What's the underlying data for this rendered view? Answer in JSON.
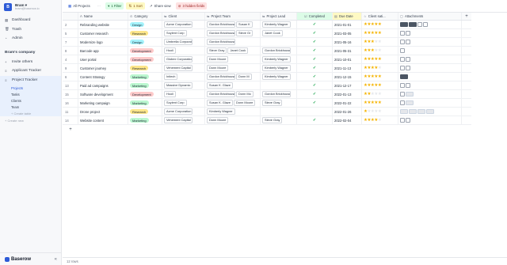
{
  "workspace": {
    "initial": "B",
    "name": "Bram",
    "email": "bram@baserow.io"
  },
  "nav": [
    {
      "icon": "dashboard-icon",
      "glyph": "▦",
      "label": "Dashboard"
    },
    {
      "icon": "trash-icon",
      "glyph": "🗑",
      "label": "Trash"
    },
    {
      "icon": "admin-icon",
      "glyph": "◔",
      "label": "Admin"
    }
  ],
  "company": {
    "title": "Bram's company",
    "items": [
      {
        "icon": "invite-icon",
        "glyph": "+",
        "label": "Invite others"
      },
      {
        "icon": "database-icon",
        "glyph": "≡",
        "label": "Applicant Tracker"
      }
    ],
    "active_db": {
      "glyph": "≡",
      "label": "Project Tracker"
    },
    "tables": [
      "Projects",
      "Tasks",
      "Clients",
      "Team"
    ],
    "create_table": "+ Create table",
    "create_new": "+ Create new"
  },
  "brand": {
    "name": "Baserow",
    "collapse": "«"
  },
  "toolbar": {
    "view": "All Projects",
    "more": "···",
    "filter": "1 Filter",
    "sort": "1 Sort",
    "share": "Share view",
    "hidden": "3 hidden fields"
  },
  "columns": {
    "name": "Name",
    "category": "Category",
    "client": "Client",
    "team": "Project Team",
    "lead": "Project Lead",
    "completed": "Completed",
    "due": "Due Date",
    "rating": "Client sati...",
    "attachments": "Attachments",
    "add": "+"
  },
  "category_colors": {
    "Design": "#a5f3fc",
    "Research": "#fde68a",
    "Development": "#fecaca",
    "Marketing": "#bbf7d0"
  },
  "rows": [
    {
      "id": "2",
      "name": "Rebranding website",
      "category": "Design",
      "client": "Acme Corporation",
      "team": [
        "Gordon Brickhouse",
        "Susan K"
      ],
      "lead": "Kimberly Wagner",
      "completed": "✓",
      "due": "2021-01-01",
      "rating": 5,
      "attachments": [
        "img-dark",
        "img-dark",
        "file",
        "file"
      ]
    },
    {
      "id": "5",
      "name": "Customer research",
      "category": "Research",
      "client": "Soylent Corp",
      "team": [
        "Gordon Brickhouse",
        "Steve Gr"
      ],
      "lead": "Janet Cook",
      "completed": "✓",
      "due": "2021-03-05",
      "rating": 5,
      "attachments": [
        "file",
        "file"
      ]
    },
    {
      "id": "7",
      "name": "Modernize logo",
      "category": "Design",
      "client": "Umbrella Corporation",
      "team": [
        "Gordon Brickhouse"
      ],
      "lead": "",
      "completed": "✓",
      "due": "2021-05-16",
      "rating": 3,
      "attachments": [
        "file",
        "file"
      ]
    },
    {
      "id": "8",
      "name": "Barcode app",
      "category": "Development",
      "client": "Hooli",
      "team": [
        "Steve Gray",
        "Janet Cook"
      ],
      "lead": "Gordon Brickhouse",
      "completed": "✓",
      "due": "2021-05-31",
      "rating": 3,
      "attachments": [
        "file"
      ]
    },
    {
      "id": "4",
      "name": "User portal",
      "category": "Development",
      "client": "Globex Corporation",
      "team": [
        "Donn Moore"
      ],
      "lead": "Kimberly Wagner",
      "completed": "✓",
      "due": "2021-10-01",
      "rating": 5,
      "attachments": [
        "file",
        "file"
      ]
    },
    {
      "id": "9",
      "name": "Customer journey",
      "category": "Research",
      "client": "Vehement Capital Pa...",
      "team": [
        "Donn Moore"
      ],
      "lead": "Kimberly Wagner",
      "completed": "✓",
      "due": "2021-11-13",
      "rating": 4,
      "attachments": [
        "file",
        "file"
      ]
    },
    {
      "id": "6",
      "name": "Content Strategy",
      "category": "Marketing",
      "client": "Initech",
      "team": [
        "Gordon Brickhouse",
        "Donn M"
      ],
      "lead": "Kimberly Wagner",
      "completed": "✓",
      "due": "2021-12-15",
      "rating": 5,
      "attachments": [
        "img-dark"
      ]
    },
    {
      "id": "13",
      "name": "Paid ad campaigns",
      "category": "Marketing",
      "client": "Massive Dynamic",
      "team": [
        "Susan K. Glaze"
      ],
      "lead": "",
      "completed": "✓",
      "due": "2021-12-17",
      "rating": 5,
      "attachments": [
        "file",
        "file"
      ]
    },
    {
      "id": "15",
      "name": "Software development",
      "category": "Development",
      "client": "Hooli",
      "team": [
        "Gordon Brickhouse",
        "Donn Mo"
      ],
      "lead": "Gordon Brickhouse",
      "completed": "✓",
      "due": "2022-01-13",
      "rating": 2,
      "attachments": [
        "file",
        "img-light"
      ]
    },
    {
      "id": "16",
      "name": "Marketing campaign",
      "category": "Marketing",
      "client": "Soylent Corp",
      "team": [
        "Susan K. Glaze",
        "Donn Moore"
      ],
      "lead": "Steve Gray",
      "completed": "✓",
      "due": "2022-01-22",
      "rating": 5,
      "attachments": [
        "file",
        "img-light"
      ]
    },
    {
      "id": "11",
      "name": "Drone project",
      "category": "Research",
      "client": "Acme Corporation",
      "team": [
        "Kimberly Wagner"
      ],
      "lead": "",
      "completed": "",
      "due": "2022-01-26",
      "rating": 1,
      "attachments": [
        "img-light",
        "img-light",
        "img-light",
        "img-light"
      ]
    },
    {
      "id": "14",
      "name": "Website content",
      "category": "Marketing",
      "client": "Vehement Capital Pa...",
      "team": [
        "Donn Moore"
      ],
      "lead": "Steve Gray",
      "completed": "✓",
      "due": "2022-02-04",
      "rating": 4,
      "attachments": [
        "file",
        "file"
      ]
    }
  ],
  "add_row": "+",
  "footer": {
    "count": "12 rows"
  }
}
